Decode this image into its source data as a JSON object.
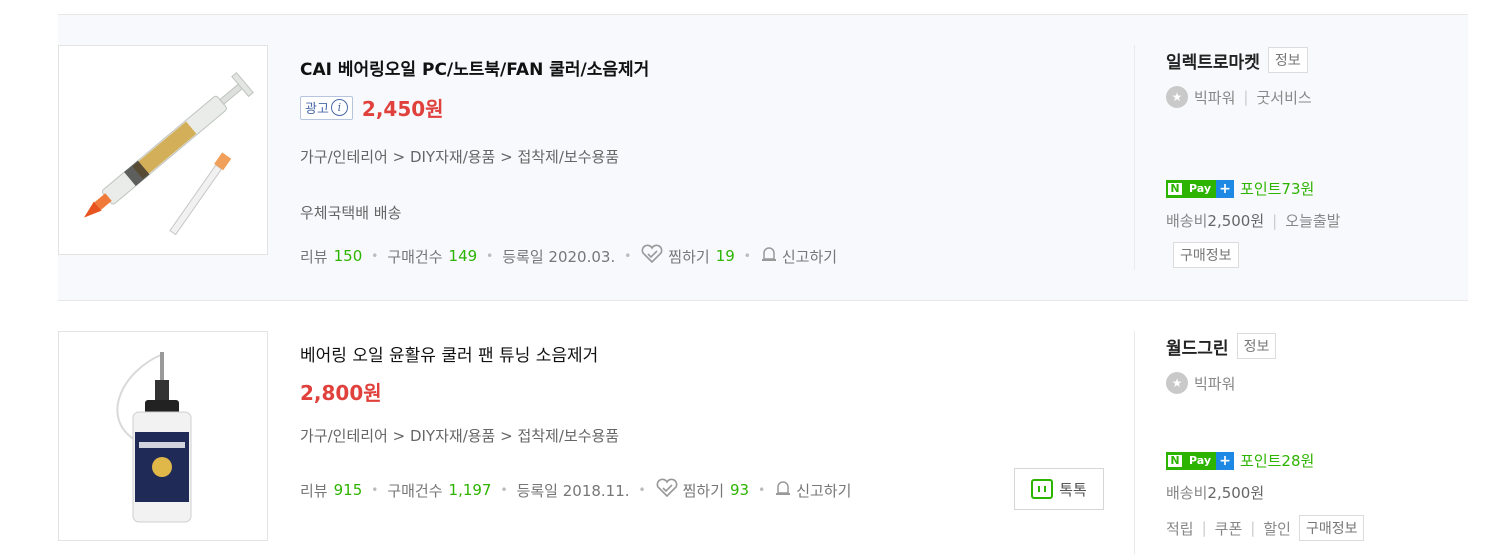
{
  "items": [
    {
      "title": "CAI 베어링오일 PC/노트북/FAN 쿨러/소음제거",
      "ad_label": "광고",
      "ad_info": "i",
      "price": "2,450원",
      "category": "가구/인테리어 > DIY자재/용품 > 접착제/보수용품",
      "shipping": "우체국택배 배송",
      "review_label": "리뷰",
      "review_count": "150",
      "purchase_label": "구매건수",
      "purchase_count": "149",
      "registered": "등록일 2020.03.",
      "wish_label": "찜하기",
      "wish_count": "19",
      "report_label": "신고하기",
      "seller": "일렉트로마켓",
      "seller_info": "정보",
      "grade": "빅파워",
      "grade_extra": "굿서비스",
      "npay_point": "포인트73원",
      "ship_fee_label": "배송비",
      "ship_fee": "2,500원",
      "today_ship": "오늘출발",
      "buy_info": "구매정보"
    },
    {
      "title": "베어링 오일 윤활유 쿨러 팬 튜닝 소음제거",
      "price": "2,800원",
      "category": "가구/인테리어 > DIY자재/용품 > 접착제/보수용품",
      "review_label": "리뷰",
      "review_count": "915",
      "purchase_label": "구매건수",
      "purchase_count": "1,197",
      "registered": "등록일 2018.11.",
      "wish_label": "찜하기",
      "wish_count": "93",
      "report_label": "신고하기",
      "talk_label": "톡톡",
      "seller": "월드그린",
      "seller_info": "정보",
      "grade": "빅파워",
      "npay_point": "포인트28원",
      "ship_fee_label": "배송비",
      "ship_fee": "2,500원",
      "extra_1": "적립",
      "extra_2": "쿠폰",
      "extra_3": "할인",
      "buy_info": "구매정보"
    }
  ],
  "npay": {
    "n": "N",
    "pay": "Pay",
    "plus": "+"
  }
}
